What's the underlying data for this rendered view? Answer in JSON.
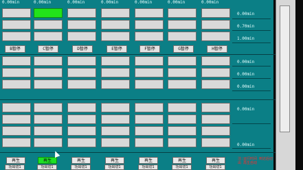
{
  "header_times": [
    "0.00min",
    "0.00min",
    "0.00min",
    "0.00min",
    "0.00min",
    "0.00min",
    "0.00min"
  ],
  "pause_buttons": [
    "B暂停",
    "C暂停",
    "D暂停",
    "E暂停",
    "F暂停",
    "G暂停",
    "H暂停"
  ],
  "right_times": [
    "0.00min",
    "0.70min",
    "1.00min",
    "0.00min",
    "0.00min",
    "0.00min",
    "0.00min",
    "0.00min"
  ],
  "bottom_buttons": [
    "再生",
    "再生",
    "再生",
    "再生",
    "再生",
    "再生",
    "再生"
  ],
  "bottom_switches": [
    "功出切1",
    "功出切1",
    "功出切1",
    "功出切1",
    "功出切1",
    "功出切1",
    "功出切1"
  ],
  "note_text": "注:运行时间\n到达后切出\n再生自动"
}
